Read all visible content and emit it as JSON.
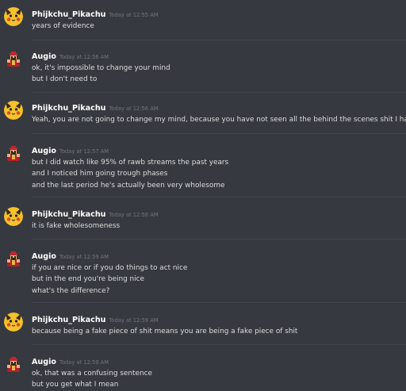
{
  "messages": [
    {
      "author": "Phijkchu_Pikachu",
      "avatar": "pikachu-avatar-icon",
      "timestamp": "Today at 12:55 AM",
      "lines": [
        "years of evidence"
      ]
    },
    {
      "author": "Augio",
      "avatar": "augio-avatar-icon",
      "timestamp": "Today at 12:56 AM",
      "lines": [
        "ok, it's impossible to change your mind",
        "but I don't need to"
      ]
    },
    {
      "author": "Phijkchu_Pikachu",
      "avatar": "pikachu-avatar-icon",
      "timestamp": "Today at 12:56 AM",
      "lines": [
        "Yeah, you are not going to change my mind, because you have not seen all the behind the scenes shit I have"
      ]
    },
    {
      "author": "Augio",
      "avatar": "augio-avatar-icon",
      "timestamp": "Today at 12:57 AM",
      "lines": [
        "but I did watch like 95% of rawb streams the past years",
        "and I noticed him going trough phases",
        "and the last period he's actually been very wholesome"
      ]
    },
    {
      "author": "Phijkchu_Pikachu",
      "avatar": "pikachu-avatar-icon",
      "timestamp": "Today at 12:58 AM",
      "lines": [
        "it is fake wholesomeness"
      ]
    },
    {
      "author": "Augio",
      "avatar": "augio-avatar-icon",
      "timestamp": "Today at 12:59 AM",
      "lines": [
        "if you are nice or if you do things to act nice",
        "but in the end you're being nice",
        "what's the difference?"
      ]
    },
    {
      "author": "Phijkchu_Pikachu",
      "avatar": "pikachu-avatar-icon",
      "timestamp": "Today at 12:59 AM",
      "lines": [
        "because being a fake piece of shit means you are being a fake piece of shit"
      ]
    },
    {
      "author": "Augio",
      "avatar": "augio-avatar-icon",
      "timestamp": "Today at 12:59 AM",
      "lines": [
        "ok, that was a confusing sentence",
        "but you get what I mean"
      ]
    }
  ],
  "colors": {
    "background": "#36393f",
    "divider": "#42454a",
    "username": "#ffffff",
    "timestamp": "#72767d",
    "text": "#dcddde"
  }
}
